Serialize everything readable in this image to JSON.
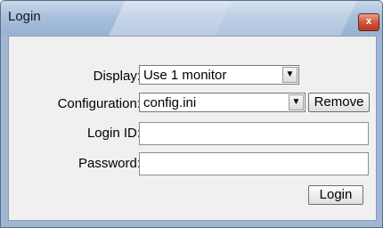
{
  "window": {
    "title": "Login",
    "close_glyph": "x"
  },
  "form": {
    "display": {
      "label": "Display:",
      "selected": "Use 1 monitor"
    },
    "configuration": {
      "label": "Configuration:",
      "selected": "config.ini",
      "remove_label": "Remove"
    },
    "login_id": {
      "label": "Login ID:",
      "value": ""
    },
    "password": {
      "label": "Password:",
      "value": ""
    },
    "login_button": "Login"
  },
  "icons": {
    "dropdown": "chevron-down-icon",
    "close": "close-icon"
  }
}
